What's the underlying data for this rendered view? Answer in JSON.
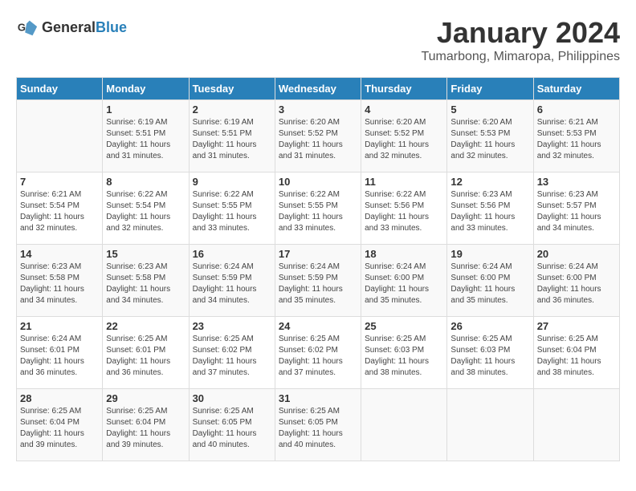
{
  "header": {
    "logo_general": "General",
    "logo_blue": "Blue",
    "month_title": "January 2024",
    "location": "Tumarbong, Mimaropa, Philippines"
  },
  "days_of_week": [
    "Sunday",
    "Monday",
    "Tuesday",
    "Wednesday",
    "Thursday",
    "Friday",
    "Saturday"
  ],
  "weeks": [
    [
      {
        "day": "",
        "info": ""
      },
      {
        "day": "1",
        "info": "Sunrise: 6:19 AM\nSunset: 5:51 PM\nDaylight: 11 hours and 31 minutes."
      },
      {
        "day": "2",
        "info": "Sunrise: 6:19 AM\nSunset: 5:51 PM\nDaylight: 11 hours and 31 minutes."
      },
      {
        "day": "3",
        "info": "Sunrise: 6:20 AM\nSunset: 5:52 PM\nDaylight: 11 hours and 31 minutes."
      },
      {
        "day": "4",
        "info": "Sunrise: 6:20 AM\nSunset: 5:52 PM\nDaylight: 11 hours and 32 minutes."
      },
      {
        "day": "5",
        "info": "Sunrise: 6:20 AM\nSunset: 5:53 PM\nDaylight: 11 hours and 32 minutes."
      },
      {
        "day": "6",
        "info": "Sunrise: 6:21 AM\nSunset: 5:53 PM\nDaylight: 11 hours and 32 minutes."
      }
    ],
    [
      {
        "day": "7",
        "info": "Sunrise: 6:21 AM\nSunset: 5:54 PM\nDaylight: 11 hours and 32 minutes."
      },
      {
        "day": "8",
        "info": "Sunrise: 6:22 AM\nSunset: 5:54 PM\nDaylight: 11 hours and 32 minutes."
      },
      {
        "day": "9",
        "info": "Sunrise: 6:22 AM\nSunset: 5:55 PM\nDaylight: 11 hours and 33 minutes."
      },
      {
        "day": "10",
        "info": "Sunrise: 6:22 AM\nSunset: 5:55 PM\nDaylight: 11 hours and 33 minutes."
      },
      {
        "day": "11",
        "info": "Sunrise: 6:22 AM\nSunset: 5:56 PM\nDaylight: 11 hours and 33 minutes."
      },
      {
        "day": "12",
        "info": "Sunrise: 6:23 AM\nSunset: 5:56 PM\nDaylight: 11 hours and 33 minutes."
      },
      {
        "day": "13",
        "info": "Sunrise: 6:23 AM\nSunset: 5:57 PM\nDaylight: 11 hours and 34 minutes."
      }
    ],
    [
      {
        "day": "14",
        "info": "Sunrise: 6:23 AM\nSunset: 5:58 PM\nDaylight: 11 hours and 34 minutes."
      },
      {
        "day": "15",
        "info": "Sunrise: 6:23 AM\nSunset: 5:58 PM\nDaylight: 11 hours and 34 minutes."
      },
      {
        "day": "16",
        "info": "Sunrise: 6:24 AM\nSunset: 5:59 PM\nDaylight: 11 hours and 34 minutes."
      },
      {
        "day": "17",
        "info": "Sunrise: 6:24 AM\nSunset: 5:59 PM\nDaylight: 11 hours and 35 minutes."
      },
      {
        "day": "18",
        "info": "Sunrise: 6:24 AM\nSunset: 6:00 PM\nDaylight: 11 hours and 35 minutes."
      },
      {
        "day": "19",
        "info": "Sunrise: 6:24 AM\nSunset: 6:00 PM\nDaylight: 11 hours and 35 minutes."
      },
      {
        "day": "20",
        "info": "Sunrise: 6:24 AM\nSunset: 6:00 PM\nDaylight: 11 hours and 36 minutes."
      }
    ],
    [
      {
        "day": "21",
        "info": "Sunrise: 6:24 AM\nSunset: 6:01 PM\nDaylight: 11 hours and 36 minutes."
      },
      {
        "day": "22",
        "info": "Sunrise: 6:25 AM\nSunset: 6:01 PM\nDaylight: 11 hours and 36 minutes."
      },
      {
        "day": "23",
        "info": "Sunrise: 6:25 AM\nSunset: 6:02 PM\nDaylight: 11 hours and 37 minutes."
      },
      {
        "day": "24",
        "info": "Sunrise: 6:25 AM\nSunset: 6:02 PM\nDaylight: 11 hours and 37 minutes."
      },
      {
        "day": "25",
        "info": "Sunrise: 6:25 AM\nSunset: 6:03 PM\nDaylight: 11 hours and 38 minutes."
      },
      {
        "day": "26",
        "info": "Sunrise: 6:25 AM\nSunset: 6:03 PM\nDaylight: 11 hours and 38 minutes."
      },
      {
        "day": "27",
        "info": "Sunrise: 6:25 AM\nSunset: 6:04 PM\nDaylight: 11 hours and 38 minutes."
      }
    ],
    [
      {
        "day": "28",
        "info": "Sunrise: 6:25 AM\nSunset: 6:04 PM\nDaylight: 11 hours and 39 minutes."
      },
      {
        "day": "29",
        "info": "Sunrise: 6:25 AM\nSunset: 6:04 PM\nDaylight: 11 hours and 39 minutes."
      },
      {
        "day": "30",
        "info": "Sunrise: 6:25 AM\nSunset: 6:05 PM\nDaylight: 11 hours and 40 minutes."
      },
      {
        "day": "31",
        "info": "Sunrise: 6:25 AM\nSunset: 6:05 PM\nDaylight: 11 hours and 40 minutes."
      },
      {
        "day": "",
        "info": ""
      },
      {
        "day": "",
        "info": ""
      },
      {
        "day": "",
        "info": ""
      }
    ]
  ]
}
